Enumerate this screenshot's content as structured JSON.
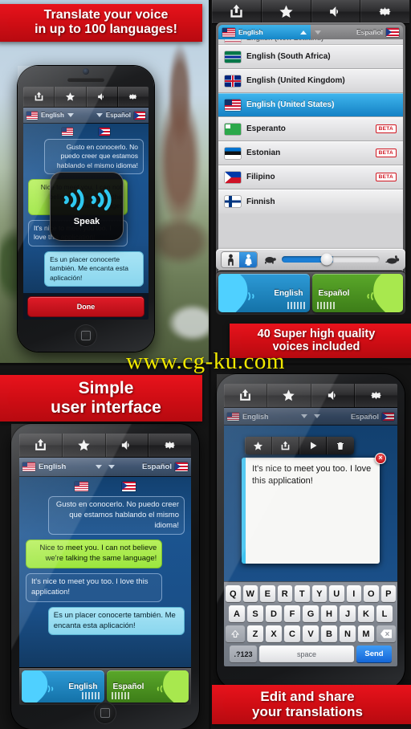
{
  "banners": {
    "top_left": "Translate your voice\nin up to 100 languages!",
    "top_left_line1": "Translate your voice",
    "top_left_line2": "in up to 100 languages!",
    "voices_line1": "40 Super high quality",
    "voices_line2": "voices included",
    "simple_line1": "Simple",
    "simple_line2": "user interface",
    "edit_line1": "Edit and share",
    "edit_line2": "your translations"
  },
  "watermark": "www.cg-ku.com",
  "toolbar": {
    "share_icon": "share-icon",
    "favorite_icon": "star-icon",
    "speaker_icon": "speaker-icon",
    "settings_icon": "gear-icon"
  },
  "lang_bar": {
    "source": "English",
    "target": "Español",
    "source_flag": "flag-us",
    "target_flag": "flag-pr"
  },
  "speak_overlay": {
    "label": "Speak",
    "done_label": "Done",
    "wave_icon": "sound-wave-icon"
  },
  "chat": {
    "messages": [
      {
        "text": "Gusto en conocerlo. No puedo creer que estamos hablando el mismo idioma!",
        "style": "src"
      },
      {
        "text": "Nice to meet you. I can not believe we're talking the same language!",
        "style": "green"
      },
      {
        "text": "It's nice to meet you too. I love this application!",
        "style": "left-out"
      },
      {
        "text": "Es un placer conocerte también. Me encanta esta aplicación!",
        "style": "cyan"
      }
    ]
  },
  "speak_buttons": {
    "left_label": "English",
    "right_label": "Español",
    "left_icon": "speaking-head-icon",
    "right_icon": "speaking-head-icon",
    "keyboard_icon": "keyboard-icon"
  },
  "picker": {
    "header_active": "English",
    "header_idle": "Español",
    "partial_row": "English (New Zealand)",
    "rows": [
      {
        "name": "English (South Africa)",
        "flag": "za",
        "beta": null,
        "selected": false
      },
      {
        "name": "English (United Kingdom)",
        "flag": "gb",
        "beta": null,
        "selected": false
      },
      {
        "name": "English (United States)",
        "flag": "us",
        "beta": null,
        "selected": true
      },
      {
        "name": "Esperanto",
        "flag": "eo",
        "beta": "BETA",
        "selected": false
      },
      {
        "name": "Estonian",
        "flag": "ee",
        "beta": "BETA",
        "selected": false
      },
      {
        "name": "Filipino",
        "flag": "ph",
        "beta": "BETA",
        "selected": false
      },
      {
        "name": "Finnish",
        "flag": "fi",
        "beta": null,
        "selected": false
      }
    ]
  },
  "voice_bar": {
    "male_icon": "male-voice-icon",
    "female_icon": "female-voice-icon",
    "slow_icon": "turtle-icon",
    "fast_icon": "rabbit-icon",
    "speed_percent": 52,
    "selected_gender": "female"
  },
  "edit_panel": {
    "tools": [
      {
        "name": "star-icon",
        "label": "Favorite"
      },
      {
        "name": "share-icon",
        "label": "Share"
      },
      {
        "name": "play-icon",
        "label": "Play"
      },
      {
        "name": "trash-icon",
        "label": "Delete"
      }
    ],
    "text": "It's nice to meet you too. I love this application!",
    "close_label": "×"
  },
  "keyboard": {
    "row1": [
      "Q",
      "W",
      "E",
      "R",
      "T",
      "Y",
      "U",
      "I",
      "O",
      "P"
    ],
    "row2": [
      "A",
      "S",
      "D",
      "F",
      "G",
      "H",
      "J",
      "K",
      "L"
    ],
    "row3": [
      "Z",
      "X",
      "C",
      "V",
      "B",
      "N",
      "M"
    ],
    "shift_icon": "shift-icon",
    "backspace_icon": "backspace-icon",
    "numbers_label": ".?123",
    "space_label": "space",
    "send_label": "Send"
  },
  "colors": {
    "red_ribbon": "#cf0d14",
    "accent_blue": "#1581c4",
    "green_bubble": "#9ce63f",
    "cyan_bubble": "#8ad6ee",
    "watermark_yellow": "#f0e800"
  }
}
